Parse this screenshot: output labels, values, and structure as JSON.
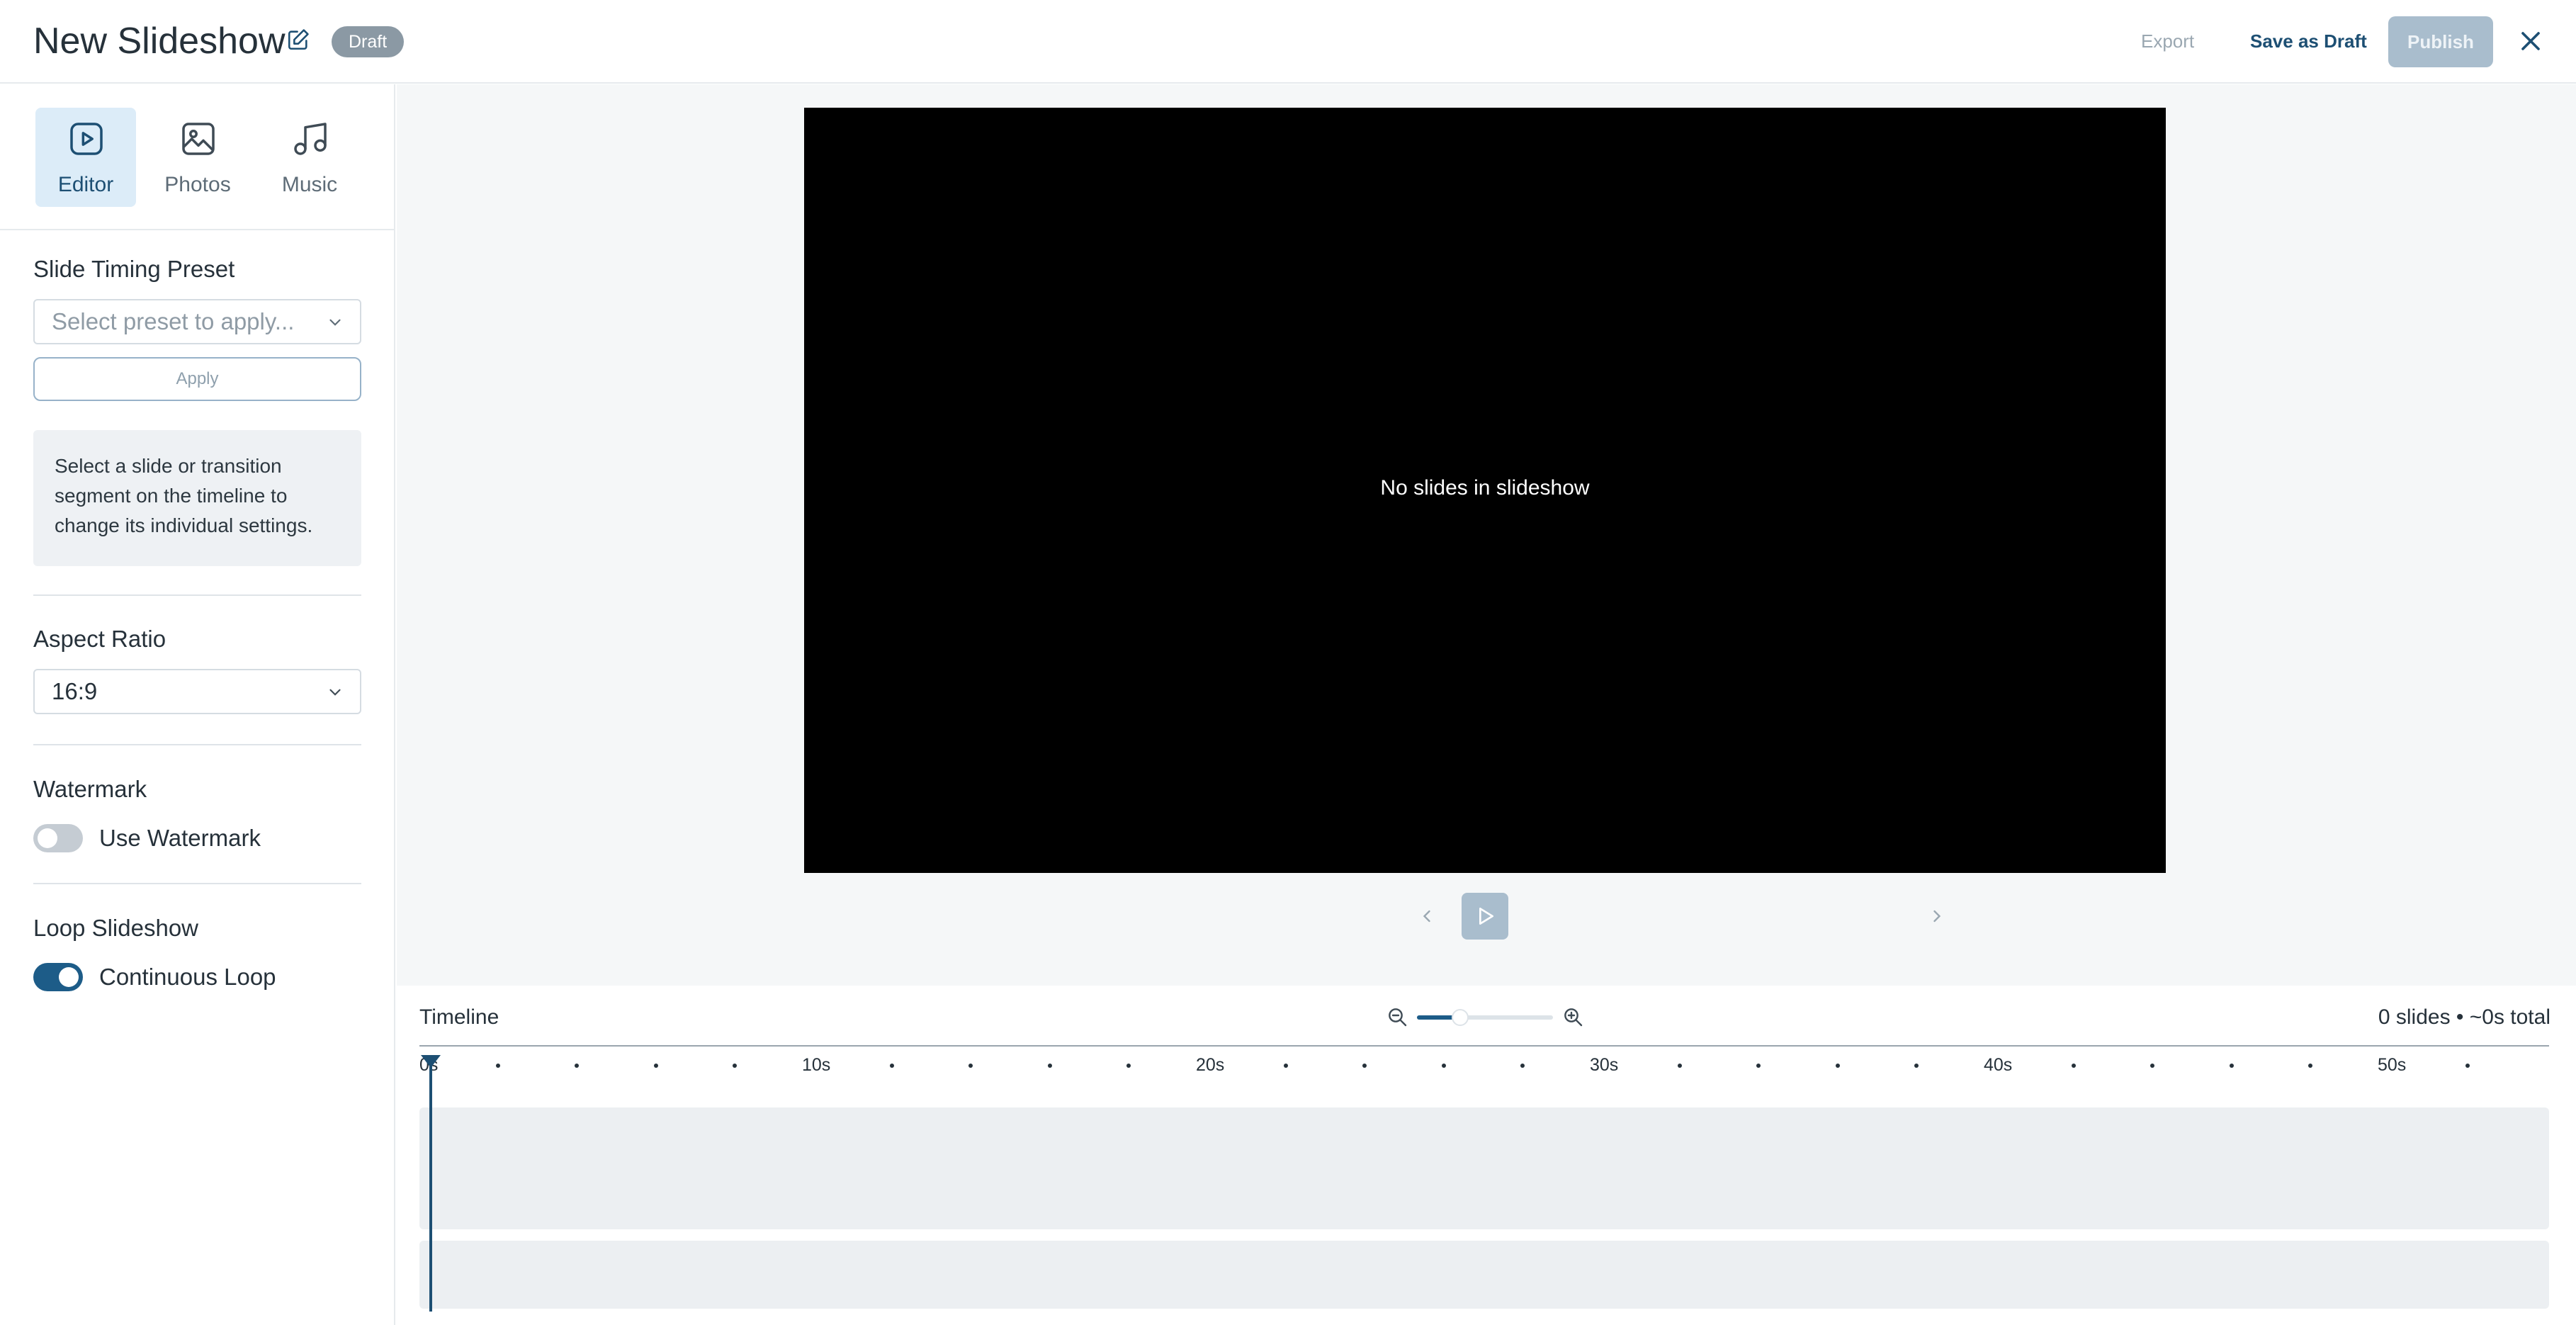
{
  "header": {
    "title": "New Slideshow",
    "status_badge": "Draft",
    "export_label": "Export",
    "save_draft_label": "Save as Draft",
    "publish_label": "Publish"
  },
  "sidebar": {
    "tabs": [
      {
        "label": "Editor",
        "icon": "play-square-icon",
        "active": true
      },
      {
        "label": "Photos",
        "icon": "image-icon",
        "active": false
      },
      {
        "label": "Music",
        "icon": "music-note-icon",
        "active": false
      }
    ],
    "timing": {
      "title": "Slide Timing Preset",
      "placeholder": "Select preset to apply...",
      "apply_label": "Apply",
      "hint": "Select a slide or transition segment on the timeline to change its individual settings."
    },
    "aspect": {
      "title": "Aspect Ratio",
      "value": "16:9"
    },
    "watermark": {
      "title": "Watermark",
      "toggle_label": "Use Watermark",
      "enabled": false
    },
    "loop": {
      "title": "Loop Slideshow",
      "toggle_label": "Continuous Loop",
      "enabled": true
    }
  },
  "preview": {
    "empty_message": "No slides in slideshow"
  },
  "timeline": {
    "title": "Timeline",
    "summary": "0 slides • ~0s total",
    "zoom_level": 0.32,
    "tick_labels": [
      "0s",
      "10s",
      "20s",
      "30s",
      "40s",
      "50s"
    ]
  },
  "colors": {
    "accent": "#1d5c88",
    "badge": "#8b99a4",
    "publish_disabled": "#a9bdcd"
  }
}
